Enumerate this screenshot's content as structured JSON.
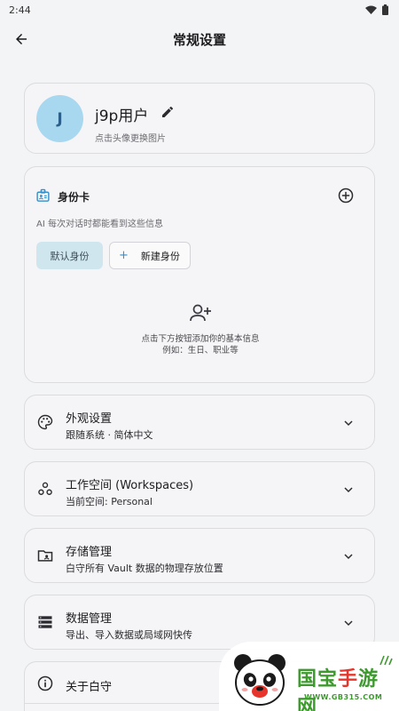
{
  "status_bar": {
    "time": "2:44"
  },
  "header": {
    "title": "常规设置"
  },
  "profile": {
    "avatar_letter": "J",
    "name": "j9p用户",
    "hint": "点击头像更换图片"
  },
  "identity": {
    "title": "身份卡",
    "description": "AI 每次对话时都能看到这些信息",
    "chips": {
      "default": "默认身份",
      "new": "新建身份",
      "new_prefix": "+"
    },
    "empty": {
      "line1": "点击下方按钮添加你的基本信息",
      "line2": "例如：生日、职业等"
    }
  },
  "settings": [
    {
      "title": "外观设置",
      "subtitle": "跟随系统 · 简体中文",
      "icon": "palette-icon"
    },
    {
      "title": "工作空间 (Workspaces)",
      "subtitle": "当前空间: Personal",
      "icon": "workspaces-icon"
    },
    {
      "title": "存储管理",
      "subtitle": "白守所有 Vault 数据的物理存放位置",
      "icon": "folder-icon"
    },
    {
      "title": "数据管理",
      "subtitle": "导出、导入数据或局域网快传",
      "icon": "storage-icon"
    }
  ],
  "about": {
    "title": "关于白守",
    "icon": "info-icon"
  },
  "watermark": {
    "brand_green": "国宝",
    "brand_red": "手",
    "brand_green2": "游网",
    "url": "WWW.GB315.COM"
  },
  "colors": {
    "accent": "#3a8ec6",
    "avatar_bg": "#a7d8ef",
    "chip_bg": "#cfe6ef",
    "background": "#f3f4f6",
    "card": "#f5f5f7"
  }
}
